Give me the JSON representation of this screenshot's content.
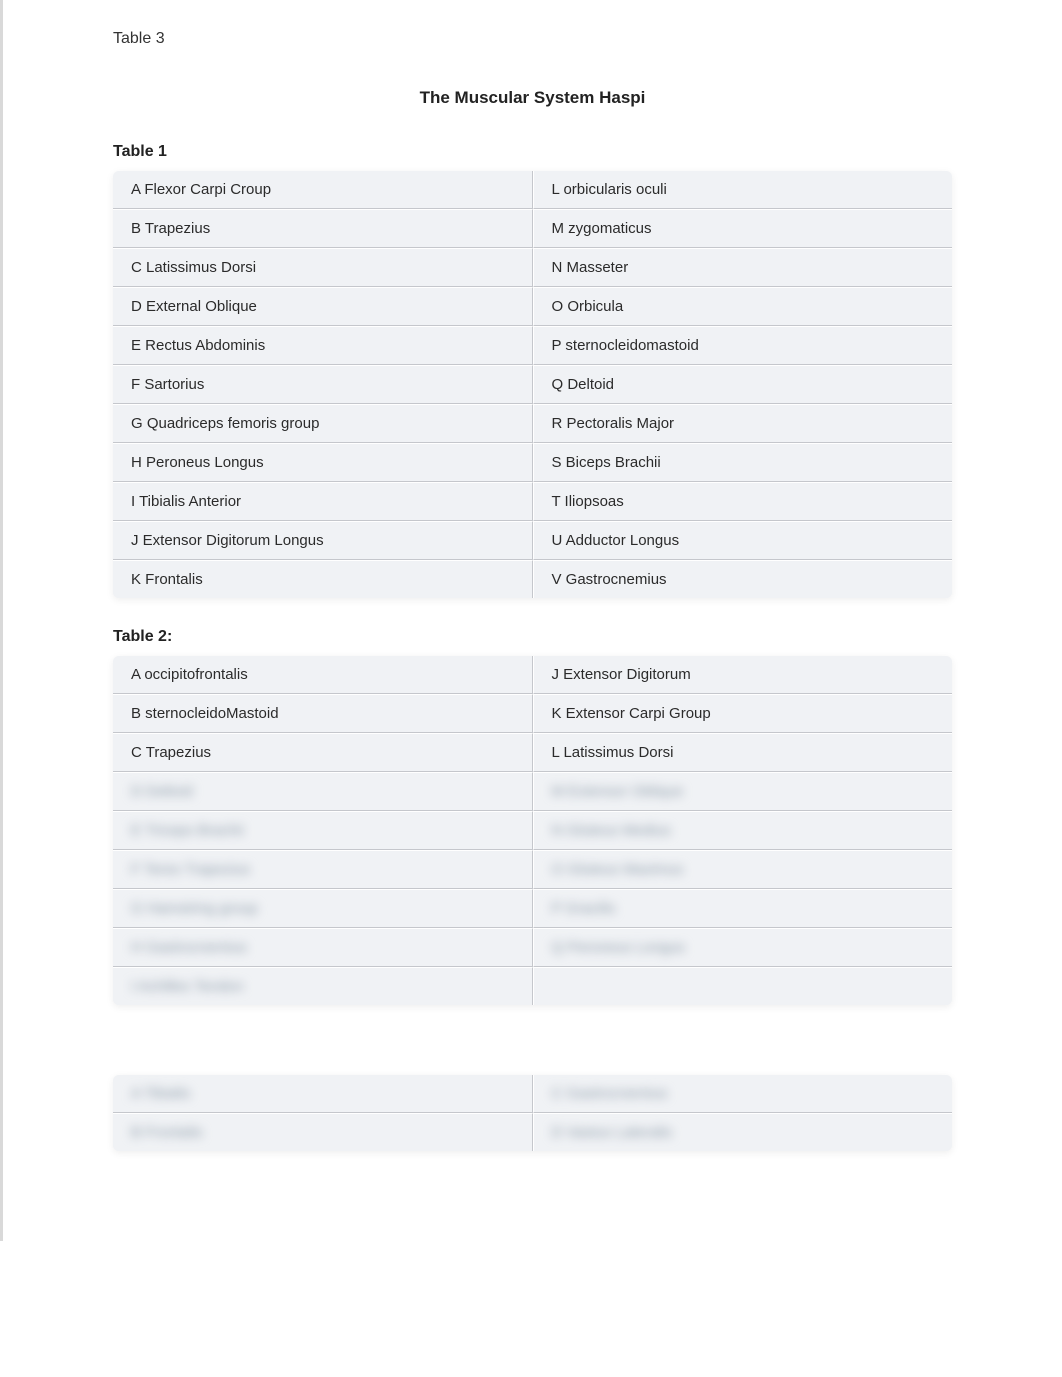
{
  "header": {
    "topLabel": "Table 3",
    "title": "The Muscular System Haspi"
  },
  "table1": {
    "heading": "Table 1",
    "rows": [
      {
        "l": "A  Flexor Carpi Croup",
        "r": "L orbicularis oculi"
      },
      {
        "l": "B Trapezius",
        "r": "M zygomaticus"
      },
      {
        "l": "C Latissimus Dorsi",
        "r": "N Masseter"
      },
      {
        "l": "D External Oblique",
        "r": "O Orbicula"
      },
      {
        "l": "E  Rectus Abdominis",
        "r": "P sternocleidomastoid"
      },
      {
        "l": "F  Sartorius",
        "r": "Q Deltoid"
      },
      {
        "l": "G Quadriceps femoris group",
        "r": "R Pectoralis Major"
      },
      {
        "l": "H Peroneus Longus",
        "r": "S Biceps Brachii"
      },
      {
        "l": "I Tibialis Anterior",
        "r": "T Iliopsoas"
      },
      {
        "l": "J Extensor Digitorum Longus",
        "r": "U Adductor Longus"
      },
      {
        "l": "K Frontalis",
        "r": "V Gastrocnemius"
      }
    ]
  },
  "table2": {
    "heading": "Table 2:",
    "rows": [
      {
        "l": "A occipitofrontalis",
        "r": "J Extensor Digitorum"
      },
      {
        "l": "B sternocleidoMastoid",
        "r": "K Extensor Carpi Group"
      },
      {
        "l": "C Trapezius",
        "r": "L Latissimus Dorsi"
      }
    ],
    "hidden_rows": [
      {
        "l": "D Deltoid",
        "r": "M Extensor Oblique"
      },
      {
        "l": "E Triceps Brachii",
        "r": "N Gluteus Medius"
      },
      {
        "l": "F Teres Trapezius",
        "r": "O Gluteus Maximus"
      },
      {
        "l": "G Hamstring group",
        "r": "P Gracilis"
      },
      {
        "l": "H Gastrocnemius",
        "r": "Q Peroneus Longus"
      },
      {
        "l": "I Achilles Tendon",
        "r": ""
      }
    ]
  },
  "table3_preview": {
    "rows": [
      {
        "l": "A Tibialis",
        "r": "C Gastrocnemius"
      },
      {
        "l": "B Frontalis",
        "r": "D Vastus Lateralis"
      }
    ]
  }
}
